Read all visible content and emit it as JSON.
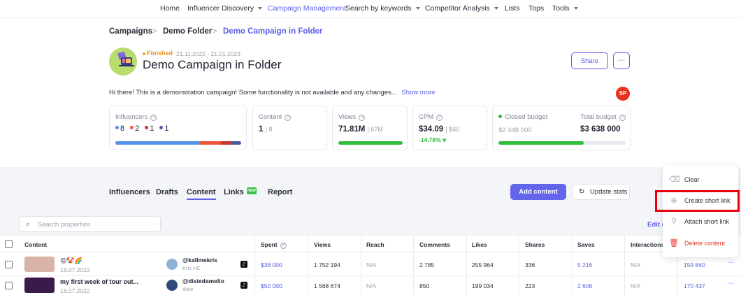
{
  "nav": {
    "items": [
      {
        "label": "Home",
        "dropdown": false,
        "active": false
      },
      {
        "label": "Influencer Discovery",
        "dropdown": true,
        "active": false
      },
      {
        "label": "Campaign Management",
        "dropdown": false,
        "active": true
      },
      {
        "label": "Search by keywords",
        "dropdown": true,
        "active": false
      },
      {
        "label": "Competitor Analysis",
        "dropdown": true,
        "active": false
      },
      {
        "label": "Lists",
        "dropdown": false,
        "active": false
      },
      {
        "label": "Tops",
        "dropdown": false,
        "active": false
      },
      {
        "label": "Tools",
        "dropdown": true,
        "active": false
      }
    ]
  },
  "breadcrumb": [
    "Campaigns",
    "Demo Folder",
    "Demo Campaign in Folder"
  ],
  "campaign": {
    "status": "Finished",
    "dates": "21.11.2022 - 21.01.2023",
    "title": "Demo Campaign in Folder",
    "description": "Hi there! This is a demonstration campaign! Some functionality is not available and any changes...",
    "show_more": "Show more",
    "user_initials": "SP"
  },
  "actions": {
    "share": "Share",
    "more": "···"
  },
  "stats": {
    "influencers": {
      "label": "Influencers",
      "legend": [
        {
          "value": "8",
          "color": "#4f8ff0"
        },
        {
          "value": "2",
          "color": "#f2543d"
        },
        {
          "value": "1",
          "color": "#c4302b"
        },
        {
          "value": "1",
          "color": "#4a5a9c"
        }
      ],
      "segments": [
        {
          "share": 0.67,
          "color": "#5592ea"
        },
        {
          "share": 0.17,
          "color": "#f0543f"
        },
        {
          "share": 0.08,
          "color": "#c3372e"
        },
        {
          "share": 0.08,
          "color": "#4b5ba0"
        }
      ]
    },
    "content": {
      "label": "Content",
      "value": "1",
      "sub": "8"
    },
    "views": {
      "label": "Views",
      "value": "71.81M",
      "sub": "67M",
      "progress": 1.0
    },
    "cpm": {
      "label": "CPM",
      "value": "$34.09",
      "sub": "$40",
      "delta": "-14.78%",
      "delta_icon": "▼"
    },
    "budget": {
      "closed_label": "Closed budget",
      "closed_value": "$2 448 000",
      "total_label": "Total budget",
      "total_value": "$3 638 000",
      "progress": 0.67
    }
  },
  "tabs": [
    {
      "label": "Influencers",
      "active": false
    },
    {
      "label": "Drafts",
      "active": false
    },
    {
      "label": "Content",
      "active": true
    },
    {
      "label": "Links",
      "active": false,
      "badge": "NEW"
    },
    {
      "label": "Report",
      "active": false
    }
  ],
  "toolbar": {
    "add_content": "Add content",
    "update_stats": "Update stats",
    "search_placeholder": "Search properties",
    "edit_columns": "Edit c"
  },
  "table": {
    "columns": [
      "Content",
      "Spent",
      "Views",
      "Reach",
      "Comments",
      "Likes",
      "Shares",
      "Saves",
      "Interactions"
    ],
    "rows": [
      {
        "title": "😜🤡🌈",
        "date": "18.07.2022",
        "handle": "@kallmekris",
        "name": "Kris HC",
        "spent": "$38 000",
        "views": "1 752 194",
        "reach": "N/A",
        "comments": "2 785",
        "likes": "255 964",
        "shares": "336",
        "saves": "5 216",
        "interactions": "N/A",
        "extra": "159 840",
        "thumb_color": "#d9b3a8",
        "avatar_color": "#8fb3d6"
      },
      {
        "title": "my first week of tour out...",
        "date": "18.07.2022",
        "handle": "@dixiedamelio",
        "name": "dixie",
        "spent": "$50 000",
        "views": "1 568 674",
        "reach": "N/A",
        "comments": "850",
        "likes": "199 034",
        "shares": "223",
        "saves": "2 606",
        "interactions": "N/A",
        "extra": "170 437",
        "thumb_color": "#3a1a4a",
        "avatar_color": "#2d4a7a"
      }
    ]
  },
  "context_menu": {
    "items": [
      {
        "label": "Clear",
        "icon": "clear-icon",
        "danger": false
      },
      {
        "label": "Create short link",
        "icon": "plus-circle-icon",
        "danger": false
      },
      {
        "label": "Attach short link",
        "icon": "paperclip-icon",
        "danger": false
      },
      {
        "label": "Delete content",
        "icon": "trash-icon",
        "danger": true
      }
    ]
  },
  "colors": {
    "accent": "#5b5ee6",
    "success": "#2fbe3c",
    "danger": "#e8321f",
    "highlight": "#e8000b"
  }
}
